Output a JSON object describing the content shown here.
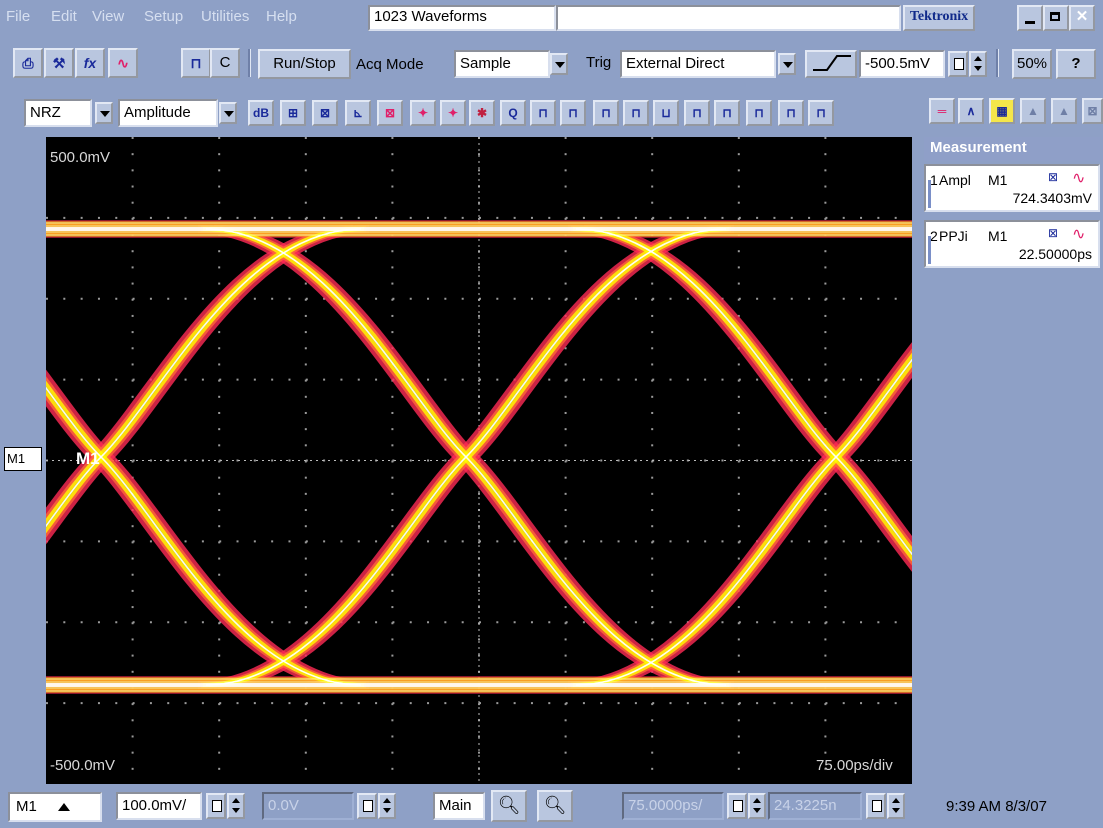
{
  "menu": [
    "File",
    "Edit",
    "View",
    "Setup",
    "Utilities",
    "Help"
  ],
  "window_title": "1023 Waveforms",
  "brand": "Tektronix",
  "toolbar": {
    "c_label": "C",
    "run_stop": "Run/Stop",
    "acq_mode_label": "Acq Mode",
    "acq_mode_value": "Sample",
    "trig_label": "Trig",
    "trig_value": "External Direct",
    "trig_level": "-500.5mV",
    "zoom_pct": "50%",
    "help_icon": "?"
  },
  "toolbar2": {
    "code_value": "NRZ",
    "measure_value": "Amplitude",
    "q_label": "Q"
  },
  "plot": {
    "top_label": "500.0mV",
    "bottom_label": "-500.0mV",
    "time_div": "75.00ps/div",
    "marker": "M1",
    "left_marker": "M1"
  },
  "measurements": {
    "title": "Measurement",
    "items": [
      {
        "num": "1",
        "name": "Ampl",
        "source": "M1",
        "value": "724.3403mV"
      },
      {
        "num": "2",
        "name": "PPJi",
        "source": "M1",
        "value": "22.50000ps"
      }
    ]
  },
  "bottom": {
    "channel": "M1",
    "vscale": "100.0mV/",
    "offset": "0.0V",
    "main": "Main",
    "hscale": "75.0000ps/",
    "hpos": "24.3225n",
    "datetime": "9:39 AM 8/3/07"
  },
  "colors": {
    "trace_dense": "#ffffff",
    "trace_mid": "#ffff00",
    "trace_edge": "#ff2a55",
    "background": "#000000"
  }
}
